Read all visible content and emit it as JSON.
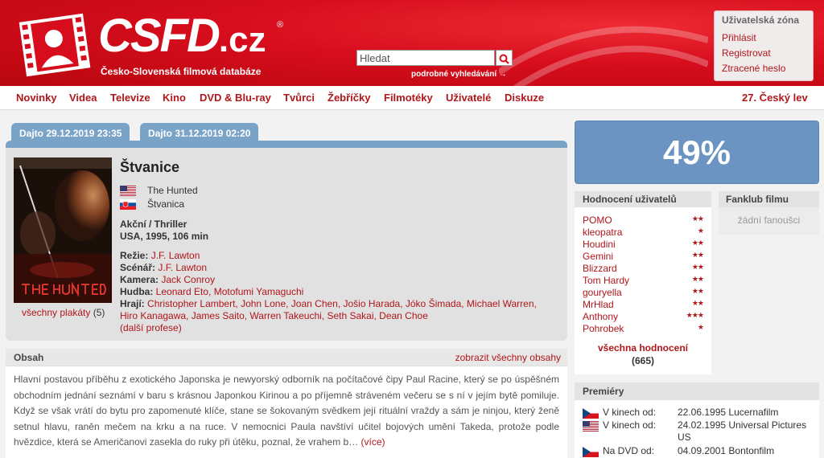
{
  "header": {
    "logo_main": "CSFD",
    "logo_suffix": ".cz",
    "logo_reg": "®",
    "tagline": "Česko-Slovenská filmová databáze",
    "search_placeholder": "Hledat",
    "advanced_search": "podrobné vyhledávání →",
    "userzone": {
      "title": "Uživatelská zóna",
      "links": [
        "Přihlásit",
        "Registrovat",
        "Ztracené heslo"
      ]
    }
  },
  "nav": {
    "items": [
      "Novinky",
      "Videa",
      "Televize",
      "Kino",
      "DVD & Blu-ray",
      "Tvůrci",
      "Žebříčky",
      "Filmotéky",
      "Uživatelé",
      "Diskuze"
    ],
    "right": "27. Český lev"
  },
  "tabs": [
    "Dajto 29.12.2019  23:35",
    "Dajto 31.12.2019  02:20"
  ],
  "film": {
    "title": "Štvanice",
    "name_original": "The Hunted",
    "name_sk": "Štvanica",
    "genre": "Akční / Thriller",
    "origin": "USA, 1995, 106 min",
    "poster_caption": "všechny plakáty",
    "poster_count": "(5)",
    "director_label": "Režie:",
    "director": "J.F. Lawton",
    "writer_label": "Scénář:",
    "writer": "J.F. Lawton",
    "camera_label": "Kamera:",
    "camera": "Jack Conroy",
    "music_label": "Hudba:",
    "music": "Leonard Eto, Motofumi Yamaguchi",
    "cast_label": "Hrají:",
    "cast": "Christopher Lambert, John Lone, Joan Chen, Jošio Harada, Jóko Šimada, Michael Warren, Hiro Kanagawa, James Saito, Warren Takeuchi, Seth Sakai, Dean Choe",
    "more": "(další profese)"
  },
  "plot": {
    "title": "Obsah",
    "show_all": "zobrazit všechny obsahy",
    "text": "Hlavní postavou příběhu z exotického Japonska je newyorský odborník na počítačové čipy Paul Racine, který se po úspěšném obchodním jednání seznámí v baru s krásnou Japonkou Kirinou a po příjemně stráveném večeru se s ní v jejím bytě pomiluje. Když se však vrátí do bytu pro zapomenuté klíče, stane se šokovaným svědkem její rituální vraždy a sám je ninjou, který ženě setnul hlavu, raněn mečem na krku a na ruce. V nemocnici Paula navštíví učitel bojových umění Takeda, protože podle hvězdice, která se Američanovi zasekla do ruky při útěku, poznal, že vrahem b…",
    "more": "(více)"
  },
  "rating": {
    "percent": "49%"
  },
  "user_ratings": {
    "title": "Hodnocení uživatelů",
    "users": [
      {
        "name": "POMO",
        "stars": "★★"
      },
      {
        "name": "kleopatra",
        "stars": "★"
      },
      {
        "name": "Houdini",
        "stars": "★★"
      },
      {
        "name": "Gemini",
        "stars": "★★"
      },
      {
        "name": "Blizzard",
        "stars": "★★"
      },
      {
        "name": "Tom Hardy",
        "stars": "★★"
      },
      {
        "name": "gouryella",
        "stars": "★★"
      },
      {
        "name": "MrHlad",
        "stars": "★★"
      },
      {
        "name": "Anthony",
        "stars": "★★★"
      },
      {
        "name": "Pohrobek",
        "stars": "★"
      }
    ],
    "all_label": "všechna hodnocení",
    "count": "(665)"
  },
  "fanclub": {
    "title": "Fanklub filmu",
    "empty": "žádní fanoušci"
  },
  "premieres": {
    "title": "Premiéry",
    "rows": [
      {
        "flag": "cz",
        "label": "V kinech od:",
        "value": "22.06.1995 Lucernafilm"
      },
      {
        "flag": "us",
        "label": "V kinech od:",
        "value": "24.02.1995 Universal Pictures US"
      },
      {
        "flag": "cz",
        "label": "Na DVD od:",
        "value": "04.09.2001 Bontonfilm"
      }
    ]
  },
  "colors": {
    "brand_red": "#d70d1d",
    "link": "#b0161a",
    "tab_blue": "#79a3c7",
    "rating_blue": "#6b94c2"
  }
}
